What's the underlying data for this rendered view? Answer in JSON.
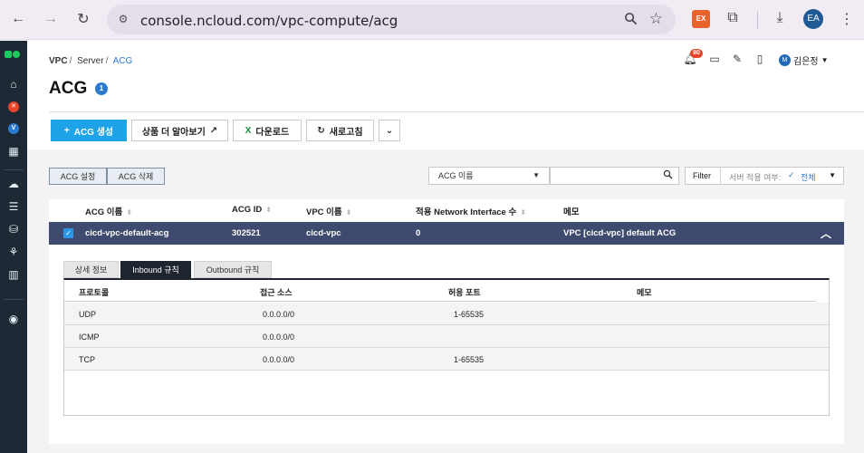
{
  "browser": {
    "url": "console.ncloud.com/vpc-compute/acg",
    "extension_label": "EX",
    "profile_initials": "EA"
  },
  "breadcrumb": [
    "VPC",
    "Server",
    "ACG"
  ],
  "header": {
    "notification_count": "80",
    "user_initial": "M",
    "user_name": "김은정"
  },
  "page": {
    "title": "ACG",
    "count": "1"
  },
  "toolbar": {
    "create_label": "ACG 생성",
    "learn_more_label": "상품 더 알아보기",
    "download_label": "다운로드",
    "refresh_label": "새로고침"
  },
  "actions": {
    "settings_label": "ACG 설정",
    "delete_label": "ACG 삭제"
  },
  "filter": {
    "select_value": "ACG 이름",
    "search_value": "",
    "filter_label": "Filter",
    "filter_name": "서버 적용 여부:",
    "filter_value": "전체"
  },
  "table": {
    "columns": [
      "ACG 이름",
      "ACG ID",
      "VPC 이름",
      "적용 Network Interface 수",
      "메모"
    ],
    "rows": [
      {
        "name": "cicd-vpc-default-acg",
        "id": "302521",
        "vpc": "cicd-vpc",
        "nic_count": "0",
        "memo": "VPC [cicd-vpc] default ACG"
      }
    ]
  },
  "detail": {
    "tabs": [
      "상세 정보",
      "Inbound 규칙",
      "Outbound 규칙"
    ],
    "active_tab": "Inbound 규칙",
    "columns": [
      "프로토콜",
      "접근 소스",
      "허용 포트",
      "메모"
    ],
    "rules": [
      {
        "protocol": "UDP",
        "source": "0.0.0.0/0",
        "port": "1-65535",
        "memo": ""
      },
      {
        "protocol": "ICMP",
        "source": "0.0.0.0/0",
        "port": "",
        "memo": ""
      },
      {
        "protocol": "TCP",
        "source": "0.0.0.0/0",
        "port": "1-65535",
        "memo": ""
      }
    ]
  },
  "colors": {
    "primary": "#1fa3e8",
    "selected_row": "#3f4b6e",
    "sidebar": "#1d2a36",
    "link": "#2a7ad0"
  }
}
